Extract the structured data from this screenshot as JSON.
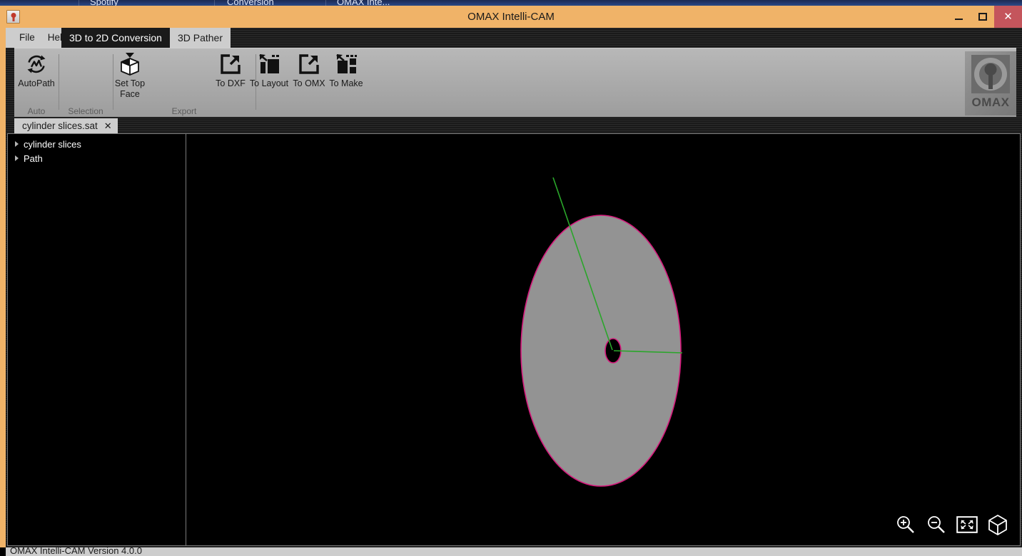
{
  "desktop": {
    "taskbar_items": [
      "Spotify",
      "Conversion",
      "OMAX Inte..."
    ]
  },
  "window": {
    "title": "OMAX Intelli-CAM",
    "app_icon": "omax-app-icon",
    "controls": {
      "minimize_label": "",
      "maximize_label": "",
      "close_label": "✕"
    }
  },
  "menu": {
    "items": [
      {
        "label": "File"
      },
      {
        "label": "Help"
      }
    ]
  },
  "main_tabs": [
    {
      "label": "3D to 2D Conversion",
      "active": false
    },
    {
      "label": "3D Pather",
      "active": true
    }
  ],
  "ribbon": {
    "groups": [
      {
        "name": "auto",
        "label": "Auto",
        "buttons": [
          {
            "label": "AutoPath",
            "icon": "autopath-icon"
          }
        ]
      },
      {
        "name": "selection",
        "label": "Selection",
        "buttons": [
          {
            "label": "Set Top\nFace",
            "line1": "Set Top",
            "line2": "Face",
            "icon": "set-top-face-icon"
          }
        ]
      },
      {
        "name": "export",
        "label": "Export",
        "buttons": [
          {
            "label": "To DXF",
            "icon": "export-arrow-icon"
          },
          {
            "label": "To Layout",
            "icon": "layout-panel-icon"
          },
          {
            "label": "To OMX",
            "icon": "export-arrow-icon"
          },
          {
            "label": "To Make",
            "icon": "make-panel-icon"
          }
        ]
      }
    ],
    "logo": {
      "wordmark": "OMAX",
      "icon": "omax-nozzle-logo"
    }
  },
  "document_tabs": [
    {
      "label": "cylinder slices.sat",
      "close_label": "✕",
      "active": true
    }
  ],
  "tree": {
    "nodes": [
      {
        "label": "cylinder slices",
        "expander": "chevron-right-icon"
      },
      {
        "label": "Path",
        "expander": "chevron-right-icon"
      }
    ]
  },
  "viewport": {
    "background_color": "#000000",
    "model": {
      "name": "cylinder slice disc",
      "fill_color": "#939393",
      "outline_color": "#d6197c",
      "hole_color": "#000000",
      "toolpath_color": "#2aa62a"
    },
    "tools": [
      {
        "name": "zoom-in-icon",
        "label": "Zoom In"
      },
      {
        "name": "zoom-out-icon",
        "label": "Zoom Out"
      },
      {
        "name": "fit-to-screen-icon",
        "label": "Fit to Screen"
      },
      {
        "name": "isometric-view-icon",
        "label": "Isometric View"
      }
    ]
  },
  "statusbar": {
    "text": "OMAX Intelli-CAM Version 4.0.0"
  },
  "colors": {
    "titlebar": "#f0b368",
    "close_button": "#c4555c",
    "ribbon": "#a9a9a9",
    "chrome_light": "#cdcdcd",
    "model_outline": "#d6197c",
    "toolpath": "#2aa62a"
  }
}
